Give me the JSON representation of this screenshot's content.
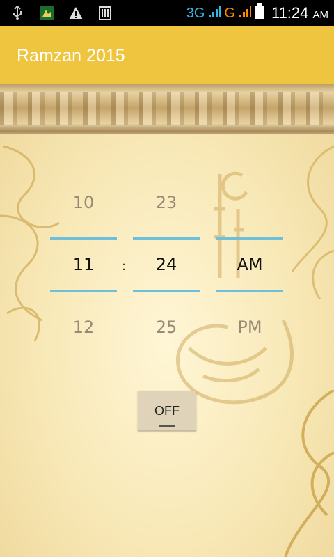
{
  "statusbar": {
    "icons": [
      "usb-icon",
      "app-notification-icon",
      "warning-icon",
      "barcode-icon"
    ],
    "network_1": "3G",
    "network_2": "G",
    "time": "11:24",
    "ampm": "AM"
  },
  "app": {
    "title": "Ramzan 2015"
  },
  "picker": {
    "hours": {
      "prev": "10",
      "current": "11",
      "next": "12"
    },
    "separator": ":",
    "minutes": {
      "prev": "23",
      "current": "24",
      "next": "25"
    },
    "period": {
      "current": "AM",
      "next": "PM"
    }
  },
  "toggle": {
    "label": "OFF",
    "state": false
  },
  "colors": {
    "actionbar": "#efc540",
    "picker_line": "#6ebfda",
    "button": "#dfd4b9"
  }
}
